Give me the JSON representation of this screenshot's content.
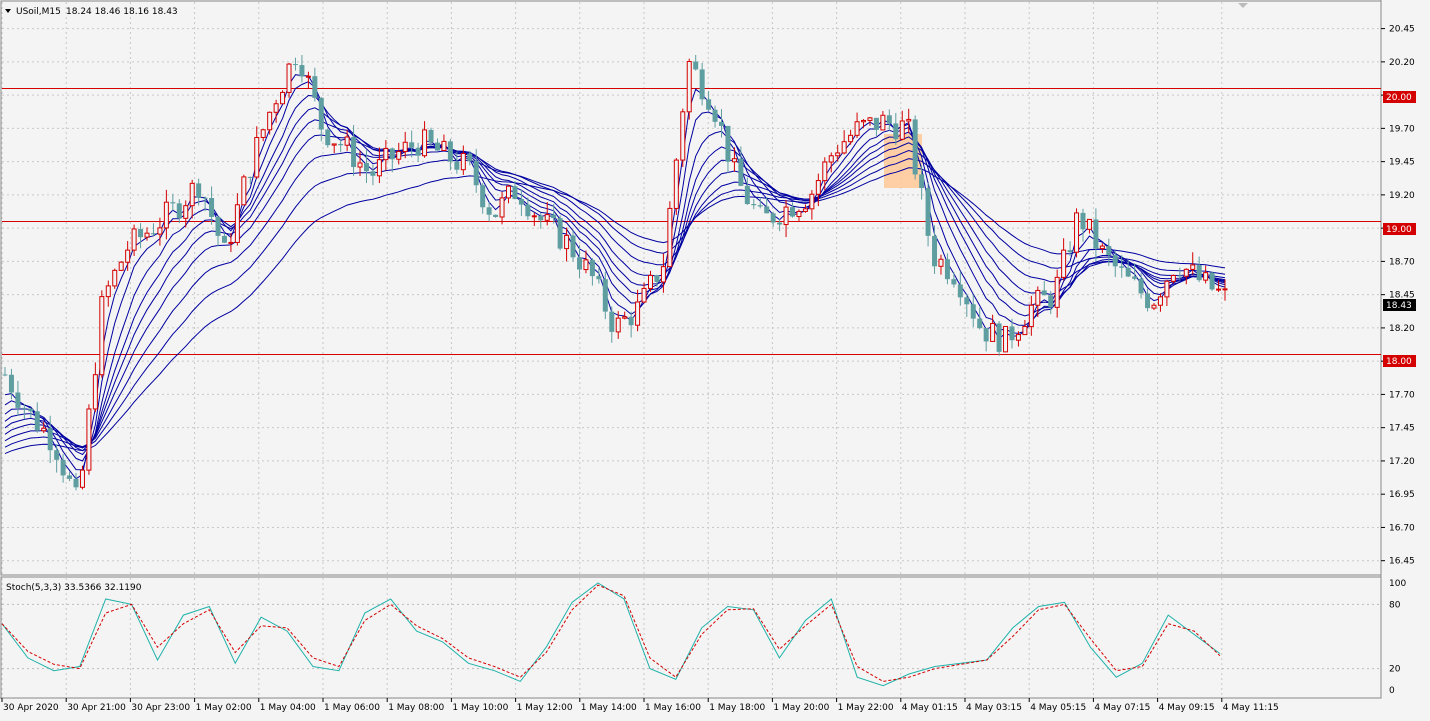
{
  "header": {
    "symbol": "USoil,M15",
    "ohlc": "18.24 18.46 18.16 18.43"
  },
  "colors": {
    "background": "#f4f4f4",
    "grid": "#c8c8c8",
    "bull": "#d40000",
    "bear": "#5f9ea0",
    "ma": "#0000a0",
    "hline": "#d40000",
    "price_tag_bg": "#000000",
    "level_tag_bg": "#d40000",
    "stoch_main": "#20b2aa",
    "stoch_signal": "#d40000",
    "highlight": "#ffc896"
  },
  "horizontal_levels": [
    "20.00",
    "19.00",
    "18.00"
  ],
  "current_price": "18.43",
  "stoch": {
    "label": "Stoch(5,3,3) 33.5366 32.1190",
    "levels": [
      "100",
      "80",
      "20",
      "0"
    ]
  },
  "chart_data": {
    "type": "candlestick",
    "price_ylim": [
      16.35,
      20.65
    ],
    "price_ticks": [
      "20.45",
      "20.20",
      "19.95",
      "19.70",
      "19.45",
      "19.20",
      "18.95",
      "18.70",
      "18.45",
      "18.20",
      "17.95",
      "17.70",
      "17.45",
      "17.20",
      "16.95",
      "16.70",
      "16.45"
    ],
    "time_labels": [
      "30 Apr 2020",
      "30 Apr 21:00",
      "30 Apr 23:00",
      "1 May 02:00",
      "1 May 04:00",
      "1 May 06:00",
      "1 May 08:00",
      "1 May 10:00",
      "1 May 12:00",
      "1 May 14:00",
      "1 May 16:00",
      "1 May 18:00",
      "1 May 20:00",
      "1 May 22:00",
      "4 May 01:15",
      "4 May 03:15",
      "4 May 05:15",
      "4 May 07:15",
      "4 May 09:15",
      "4 May 11:15"
    ],
    "close_path": [
      17.85,
      17.55,
      17.35,
      16.85,
      18.4,
      18.8,
      18.95,
      19.1,
      19.3,
      18.75,
      19.4,
      19.9,
      20.3,
      19.7,
      19.55,
      19.35,
      19.5,
      19.6,
      19.5,
      19.4,
      19.05,
      19.25,
      19.0,
      18.85,
      18.6,
      18.2,
      18.35,
      18.7,
      20.2,
      19.9,
      19.3,
      19.0,
      19.1,
      19.2,
      19.55,
      19.7,
      19.75,
      19.7,
      18.75,
      18.6,
      18.2,
      18.1,
      18.35,
      18.45,
      19.05,
      18.75,
      18.55,
      18.4,
      18.7,
      18.55,
      18.43
    ],
    "stoch_main_path": [
      62,
      30,
      18,
      22,
      85,
      80,
      28,
      70,
      78,
      25,
      68,
      55,
      22,
      18,
      72,
      85,
      55,
      45,
      25,
      18,
      8,
      40,
      82,
      100,
      85,
      20,
      10,
      58,
      78,
      75,
      30,
      65,
      85,
      12,
      4,
      15,
      22,
      25,
      28,
      58,
      78,
      82,
      40,
      12,
      25,
      70,
      52,
      34
    ],
    "stoch_signal_path": [
      62,
      36,
      24,
      20,
      72,
      80,
      40,
      62,
      75,
      35,
      60,
      58,
      30,
      22,
      65,
      80,
      60,
      48,
      30,
      22,
      12,
      35,
      75,
      98,
      88,
      30,
      12,
      52,
      75,
      76,
      38,
      60,
      80,
      22,
      8,
      12,
      20,
      24,
      28,
      50,
      75,
      80,
      48,
      18,
      22,
      62,
      55,
      32
    ]
  }
}
